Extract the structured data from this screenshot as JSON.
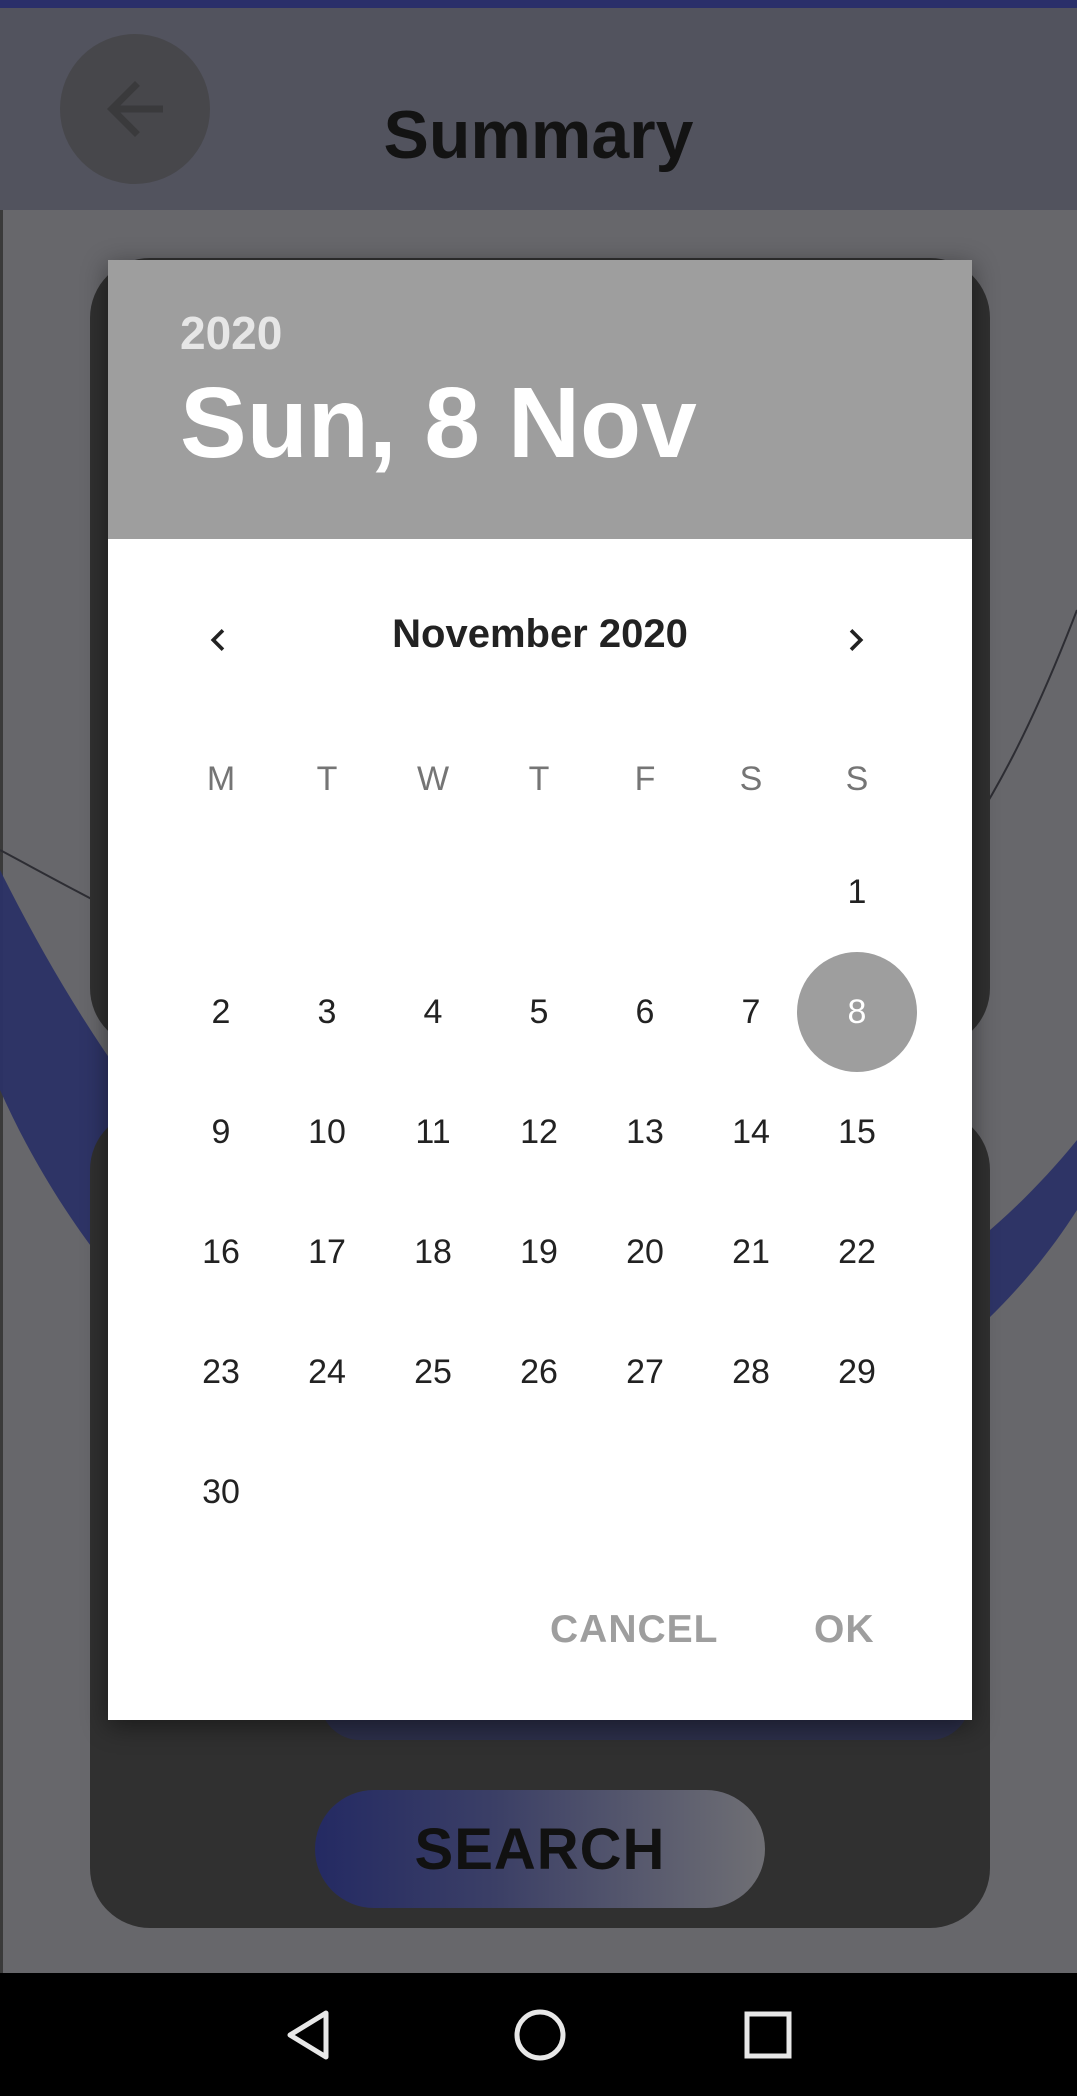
{
  "app": {
    "title": "Summary",
    "search_label": "SEARCH",
    "accent_color": "#2a2f6a"
  },
  "dialog": {
    "year": "2020",
    "selected_date": "Sun, 8 Nov",
    "month_label": "November 2020",
    "weekdays": [
      "M",
      "T",
      "W",
      "T",
      "F",
      "S",
      "S"
    ],
    "selected_day": "8",
    "days": [
      "1",
      "2",
      "3",
      "4",
      "5",
      "6",
      "7",
      "8",
      "9",
      "10",
      "11",
      "12",
      "13",
      "14",
      "15",
      "16",
      "17",
      "18",
      "19",
      "20",
      "21",
      "22",
      "23",
      "24",
      "25",
      "26",
      "27",
      "28",
      "29",
      "30"
    ],
    "cancel_label": "CANCEL",
    "ok_label": "OK",
    "header_color": "#9e9e9e"
  },
  "icons": {
    "back": "arrow-left-icon",
    "prev_month": "chevron-left-icon",
    "next_month": "chevron-right-icon",
    "nav_back": "triangle-back-icon",
    "nav_home": "circle-home-icon",
    "nav_recents": "square-recents-icon"
  }
}
